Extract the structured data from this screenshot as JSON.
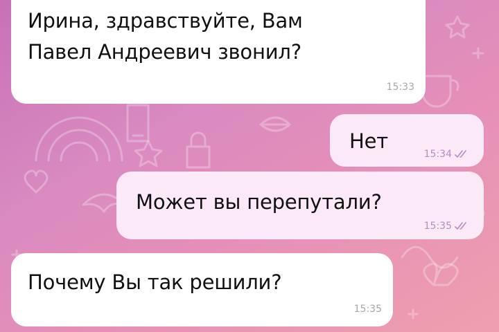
{
  "chat": {
    "wallpaper_gradient": [
      "#c870b8",
      "#ef9fae"
    ],
    "incoming_bubble_color": "#ffffff",
    "outgoing_bubble_color": "#fbe9f7",
    "read_check_color": "#b48cc4",
    "messages": [
      {
        "direction": "incoming",
        "lines": [
          "Ирина, здравствуйте, Вам",
          "Павел Андреевич звонил?"
        ],
        "time": "15:33"
      },
      {
        "direction": "outgoing",
        "lines": [
          "Нет"
        ],
        "time": "15:34",
        "status_icon": "double-check-icon"
      },
      {
        "direction": "outgoing",
        "lines": [
          "Может вы перепутали?"
        ],
        "time": "15:35",
        "status_icon": "double-check-icon"
      },
      {
        "direction": "incoming",
        "lines": [
          "Почему Вы так решили?"
        ],
        "time": "15:35"
      }
    ]
  }
}
